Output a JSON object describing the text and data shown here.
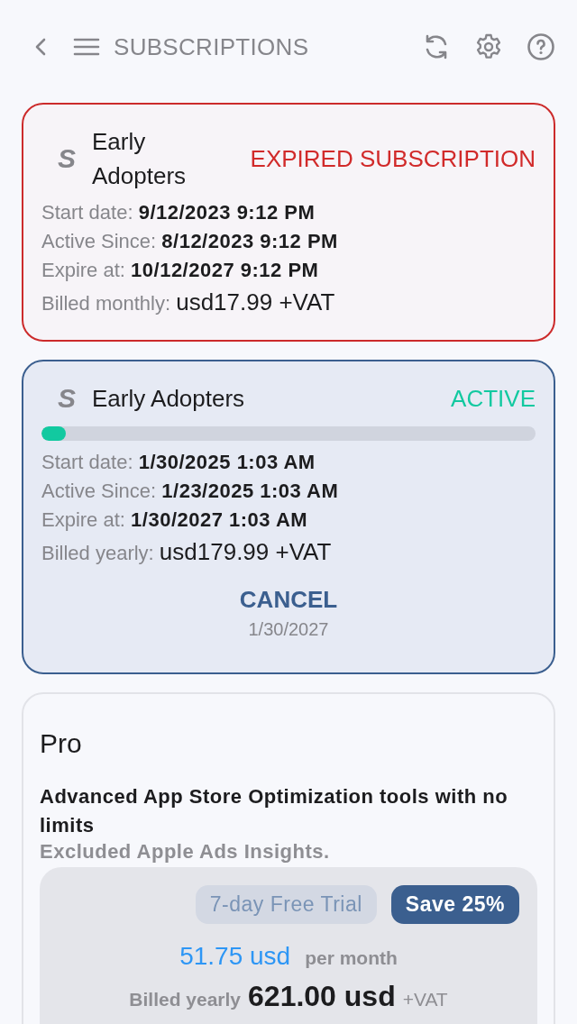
{
  "header": {
    "title": "SUBSCRIPTIONS"
  },
  "subscriptions": [
    {
      "logo": "S",
      "name": "Early Adopters",
      "status": "EXPIRED SUBSCRIPTION",
      "kind": "expired",
      "details": [
        {
          "label": "Start date:",
          "value": "9/12/2023 9:12 PM"
        },
        {
          "label": "Active Since:",
          "value": "8/12/2023 9:12 PM"
        },
        {
          "label": "Expire at:",
          "value": "10/12/2027 9:12 PM"
        }
      ],
      "billing": {
        "label": "Billed monthly:",
        "value": "usd17.99 +VAT"
      }
    },
    {
      "logo": "S",
      "name": "Early Adopters",
      "status": "ACTIVE",
      "kind": "active",
      "level": 0.05,
      "details": [
        {
          "label": "Start date:",
          "value": "1/30/2025 1:03 AM"
        },
        {
          "label": "Active Since:",
          "value": "1/23/2025 1:03 AM"
        },
        {
          "label": "Expire at:",
          "value": "1/30/2027 1:03 AM"
        }
      ],
      "billing": {
        "label": "Billed yearly:",
        "value": "usd179.99 +VAT"
      },
      "cancel": {
        "label": "CANCEL",
        "date": "1/30/2027"
      }
    }
  ],
  "plan": {
    "name": "Pro",
    "description": "Advanced App Store Optimization tools with no limits",
    "note": "Excluded Apple Ads Insights.",
    "badges": [
      {
        "kind": "trial",
        "label": "7-day Free Trial"
      },
      {
        "kind": "save",
        "label": "Save 25%"
      }
    ],
    "monthly_price": "51.75 usd",
    "monthly_unit": "per month",
    "billed_label": "Billed yearly",
    "yearly_price": "621.00 usd",
    "vat": "+VAT"
  }
}
